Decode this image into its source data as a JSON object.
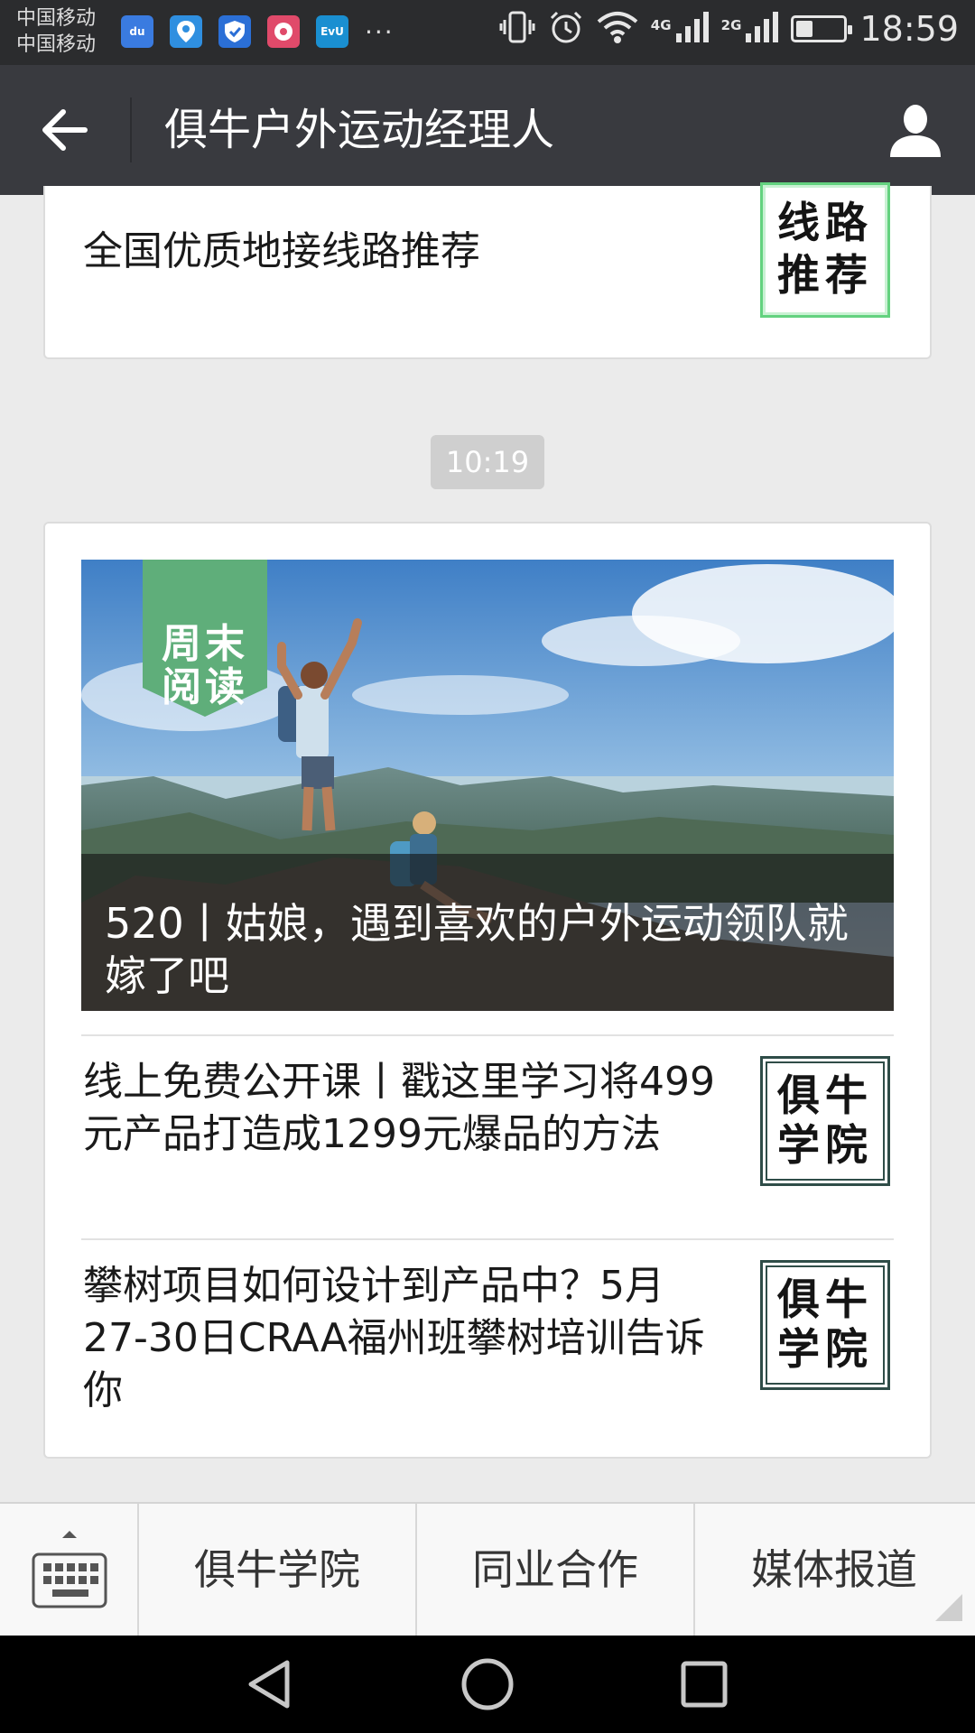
{
  "status_bar": {
    "carrier_line1": "中国移动",
    "carrier_line2": "中国移动",
    "notification_icons": [
      "baidu-icon",
      "location-icon",
      "shield-icon",
      "music-icon",
      "evernote-icon"
    ],
    "baidu_text": "du",
    "evernote_text": "EvU",
    "more": "···",
    "net1": "4G",
    "net2": "2G",
    "battery_level": 0.35,
    "time": "18:59"
  },
  "header": {
    "title": "俱牛户外运动经理人",
    "back_icon": "arrow-left-icon",
    "profile_icon": "person-icon"
  },
  "top_card": {
    "text": "全国优质地接线路推荐",
    "thumb_line1": "线路",
    "thumb_line2": "推荐"
  },
  "timestamp": "10:19",
  "main_card": {
    "cover": {
      "tag_line1": "周末",
      "tag_line2": "阅读",
      "title": "520丨姑娘，遇到喜欢的户外运动领队就嫁了吧"
    },
    "items": [
      {
        "text": "线上免费公开课丨戳这里学习将499元产品打造成1299元爆品的方法",
        "thumb_line1": "俱牛",
        "thumb_line2": "学院"
      },
      {
        "text": "攀树项目如何设计到产品中？5月27-30日CRAA福州班攀树培训告诉你",
        "thumb_line1": "俱牛",
        "thumb_line2": "学院"
      }
    ]
  },
  "menu": {
    "keyboard_icon": "keyboard-icon",
    "items": [
      "俱牛学院",
      "同业合作",
      "媒体报道"
    ]
  },
  "nav": {
    "back_icon": "nav-back-icon",
    "home_icon": "nav-home-icon",
    "recents_icon": "nav-recents-icon"
  },
  "colors": {
    "titlebar": "#393a3f",
    "statusbar": "#2b2c2e",
    "tag_green": "#5fae7a",
    "thumb_green_border": "#63d27f"
  }
}
